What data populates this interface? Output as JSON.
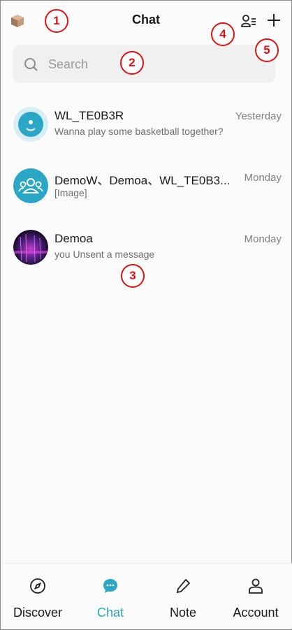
{
  "header": {
    "title": "Chat",
    "left_icon": "cube-icon",
    "right_icons": [
      "contacts-list-icon",
      "plus-icon"
    ]
  },
  "search": {
    "placeholder": "Search",
    "value": ""
  },
  "chats": [
    {
      "name": "WL_TE0B3R",
      "time": "Yesterday",
      "preview": "Wanna play some basketball together?",
      "avatar": "default-user-avatar"
    },
    {
      "name": "DemoW、Demoa、WL_TE0B3...",
      "time": "Monday",
      "preview": "[Image]",
      "avatar": "group-avatar"
    },
    {
      "name": "Demoa",
      "time": "Monday",
      "preview": "you Unsent a message",
      "avatar": "photo-avatar"
    }
  ],
  "annotations": [
    "1",
    "2",
    "3",
    "4",
    "5"
  ],
  "nav": [
    {
      "label": "Discover",
      "icon": "compass-icon",
      "active": false
    },
    {
      "label": "Chat",
      "icon": "chat-bubble-icon",
      "active": true
    },
    {
      "label": "Note",
      "icon": "pencil-icon",
      "active": false
    },
    {
      "label": "Account",
      "icon": "person-icon",
      "active": false
    }
  ],
  "colors": {
    "accent": "#2aa6c6",
    "annotation": "#e01010",
    "background": "#fbfbfb"
  }
}
